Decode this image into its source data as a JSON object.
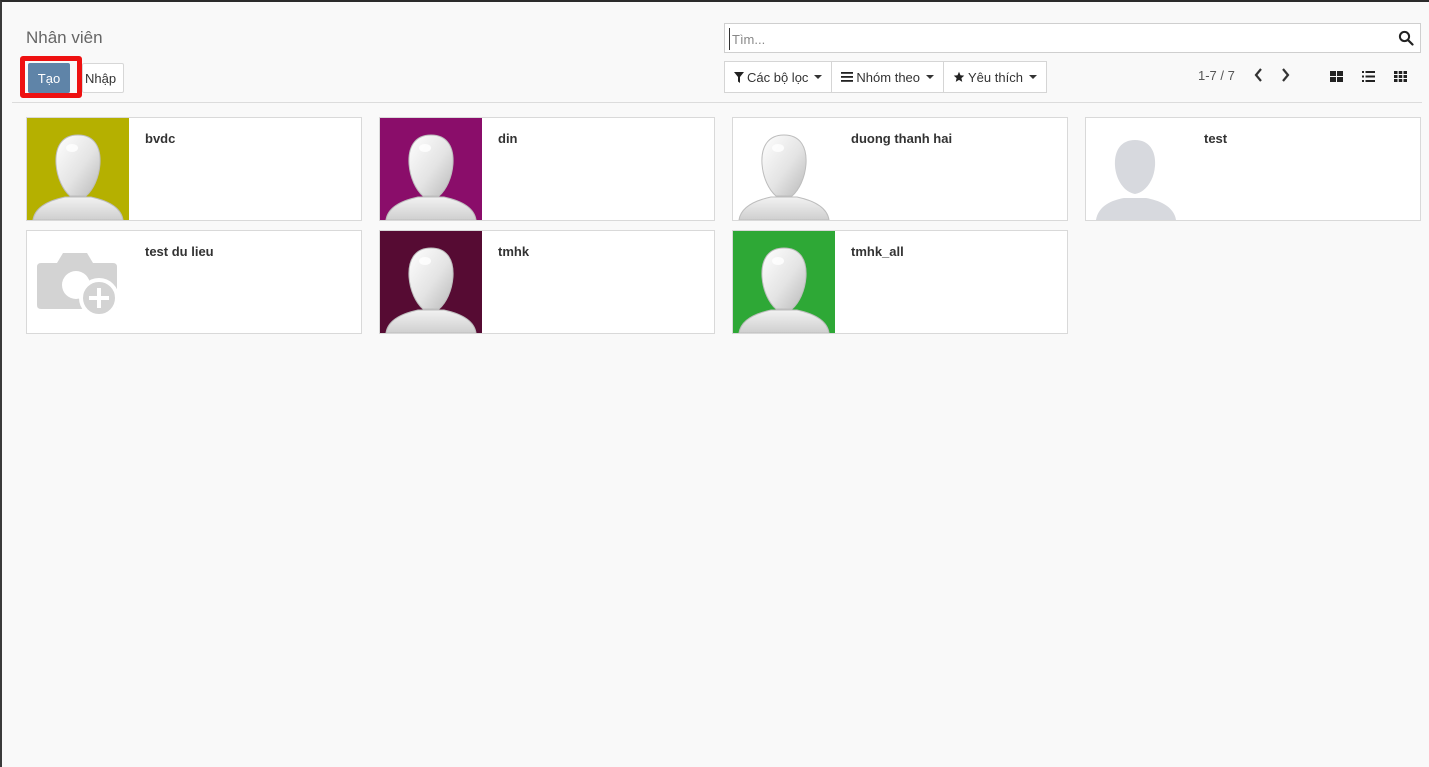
{
  "control_panel": {
    "title": "Nhân viên",
    "create_label": "Tạo",
    "import_label": "Nhập",
    "search_placeholder": "Tìm...",
    "filters_label": "Các bộ lọc",
    "groupby_label": "Nhóm theo",
    "favorites_label": "Yêu thích",
    "pager_text": "1-7 / 7",
    "highlight_color": "#ee1111",
    "primary_color": "#5f84a8"
  },
  "employees": [
    {
      "name": "bvdc",
      "photo": "avatar-silhouette",
      "bg": "#b5b000"
    },
    {
      "name": "din",
      "photo": "avatar-silhouette",
      "bg": "#8a0d6a"
    },
    {
      "name": "duong thanh hai",
      "photo": "avatar-silhouette",
      "bg": "#ffffff"
    },
    {
      "name": "test",
      "photo": "person-placeholder",
      "bg": "#ffffff"
    },
    {
      "name": "test du lieu",
      "photo": "camera-plus",
      "bg": "#ffffff"
    },
    {
      "name": "tmhk",
      "photo": "avatar-silhouette",
      "bg": "#560b33"
    },
    {
      "name": "tmhk_all",
      "photo": "avatar-silhouette",
      "bg": "#2ea836"
    }
  ]
}
